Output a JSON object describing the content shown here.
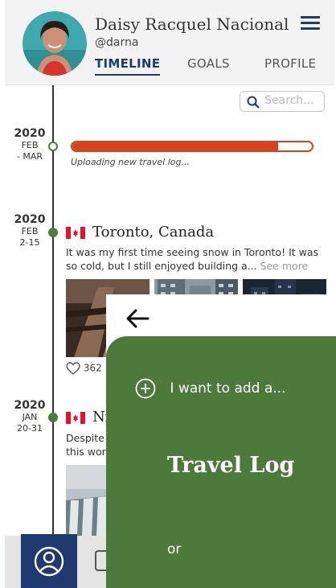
{
  "user": {
    "name": "Daisy Racquel Nacional",
    "handle": "@darna"
  },
  "tabs": [
    {
      "label": "TIMELINE",
      "active": true
    },
    {
      "label": "GOALS",
      "active": false
    },
    {
      "label": "PROFILE",
      "active": false
    }
  ],
  "search": {
    "placeholder": "Search..."
  },
  "upload": {
    "year": "2020",
    "month": "FEB",
    "range": "- MAR",
    "status": "Uploading new travel log...",
    "progress": 0.86
  },
  "entries": [
    {
      "year": "2020",
      "month": "FEB",
      "range": "2-15",
      "title": "Toronto, Canada",
      "description": "It was my first time seeing snow in Toronto! It was so cold, but I still enjoyed building a...",
      "see_more": "See more",
      "likes": "362"
    },
    {
      "year": "2020",
      "month": "JAN",
      "range": "20-31",
      "title": "Ni",
      "description": "Despite\nthis wor"
    }
  ],
  "overlay": {
    "add_prompt": "I want to add a...",
    "option_travel": "Travel Log",
    "or_text": "or"
  },
  "colors": {
    "brand_navy": "#1e3a6e",
    "accent_green": "#4b7a3b",
    "progress_red": "#d6431f"
  }
}
